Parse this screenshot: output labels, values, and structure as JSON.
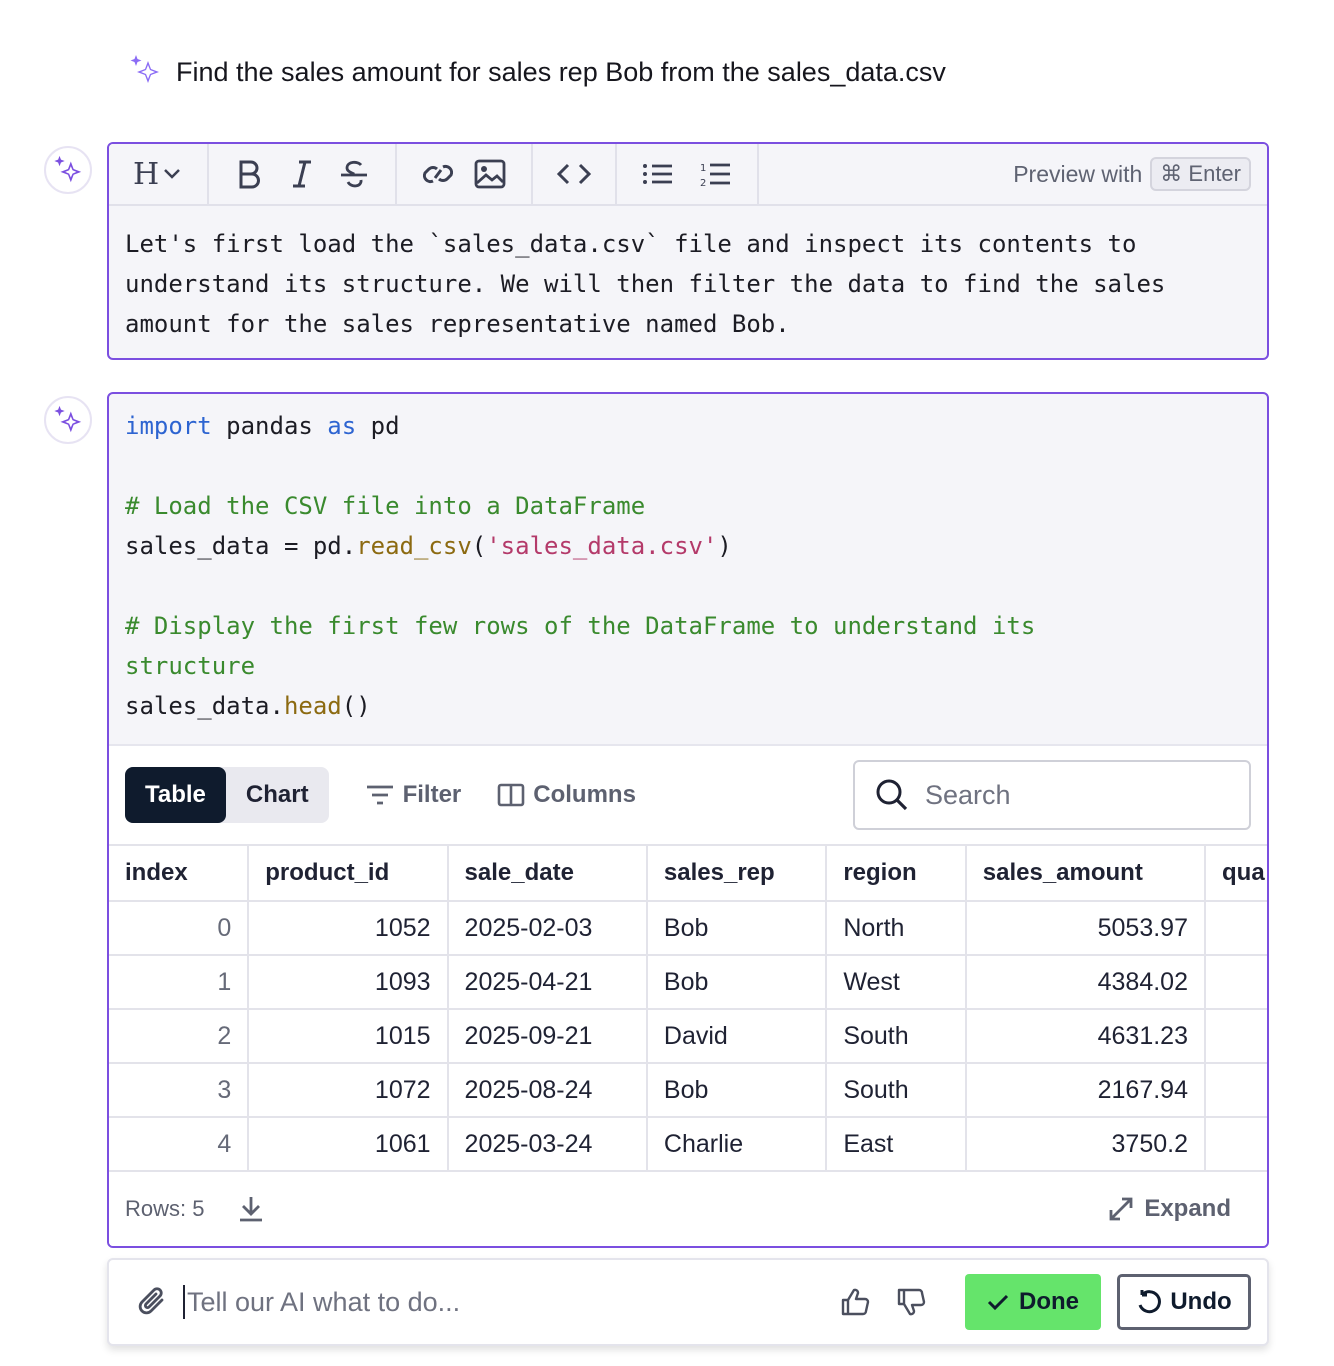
{
  "prompt": {
    "text": "Find the sales amount for sales rep Bob from the sales_data.csv"
  },
  "markdown_cell": {
    "toolbar": {
      "heading_label": "H",
      "preview_label": "Preview with",
      "preview_key": "⌘ Enter"
    },
    "lines": [
      "Let's first load the `sales_data.csv` file and inspect its contents to",
      "understand its structure. We will then filter the data to find the sales",
      "amount for the sales representative named Bob."
    ]
  },
  "code_cell": {
    "line1": {
      "kw1": "import",
      "mid": " pandas ",
      "kw2": "as",
      "end": " pd"
    },
    "line3": "# Load the CSV file into a DataFrame",
    "line4": {
      "a": "sales_data = pd.",
      "fn": "read_csv",
      "b": "(",
      "str": "'sales_data.csv'",
      "c": ")"
    },
    "line6": "# Display the first few rows of the DataFrame to understand its",
    "line7": "structure",
    "line8": {
      "a": "sales_data.",
      "fn": "head",
      "b": "()"
    }
  },
  "output": {
    "tabs": {
      "table": "Table",
      "chart": "Chart"
    },
    "filter_label": "Filter",
    "columns_label": "Columns",
    "search_placeholder": "Search",
    "headers": [
      "index",
      "product_id",
      "sale_date",
      "sales_rep",
      "region",
      "sales_amount",
      "qua"
    ],
    "rows": [
      [
        "0",
        "1052",
        "2025-02-03",
        "Bob",
        "North",
        "5053.97",
        ""
      ],
      [
        "1",
        "1093",
        "2025-04-21",
        "Bob",
        "West",
        "4384.02",
        ""
      ],
      [
        "2",
        "1015",
        "2025-09-21",
        "David",
        "South",
        "4631.23",
        ""
      ],
      [
        "3",
        "1072",
        "2025-08-24",
        "Bob",
        "South",
        "2167.94",
        ""
      ],
      [
        "4",
        "1061",
        "2025-03-24",
        "Charlie",
        "East",
        "3750.2",
        ""
      ]
    ],
    "rows_label": "Rows: 5",
    "expand_label": "Expand"
  },
  "input_bar": {
    "placeholder": "Tell our AI what to do...",
    "done_label": "Done",
    "undo_label": "Undo"
  },
  "colors": {
    "accent": "#7b4fe0",
    "done_green": "#65e46b",
    "dark": "#0f1b2d"
  }
}
